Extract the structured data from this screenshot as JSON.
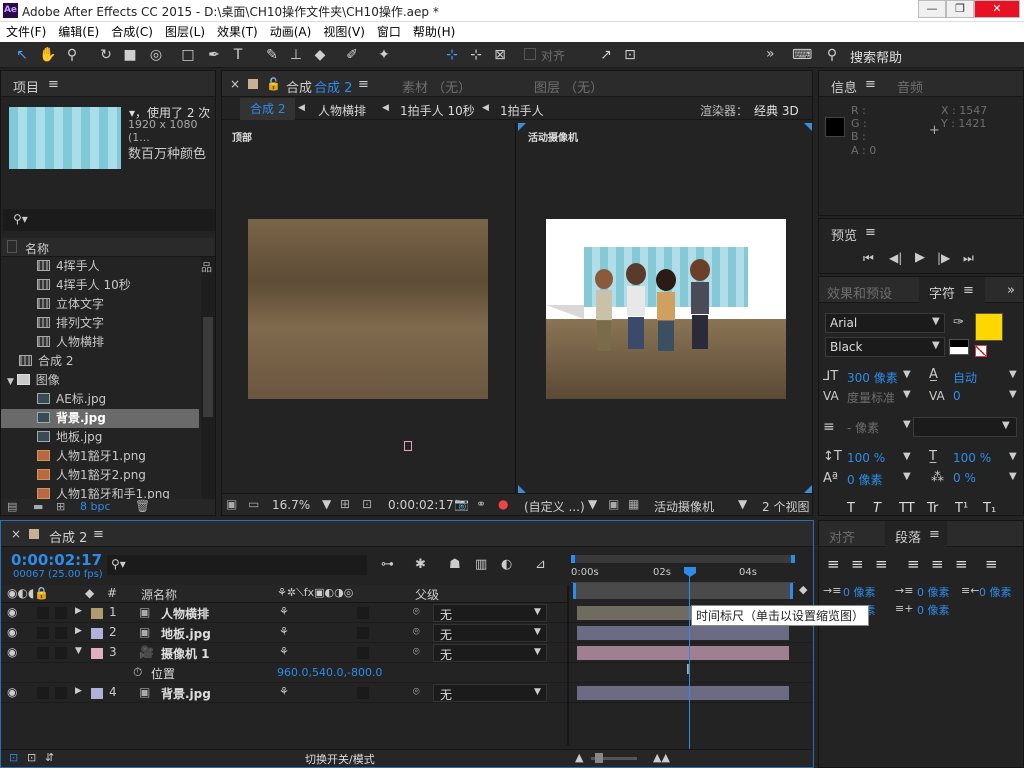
{
  "window": {
    "app_badge": "Ae",
    "title": "Adobe After Effects CC 2015 - D:\\桌面\\CH10操作文件夹\\CH10操作.aep *",
    "minimize": "—",
    "restore": "❐",
    "close": "✕"
  },
  "menu": [
    "文件(F)",
    "编辑(E)",
    "合成(C)",
    "图层(L)",
    "效果(T)",
    "动画(A)",
    "视图(V)",
    "窗口",
    "帮助(H)"
  ],
  "toolbar": {
    "align_label": "对齐",
    "search_help": "搜索帮助",
    "more": "»"
  },
  "project": {
    "tab": "项目",
    "menu_icon": "≡",
    "used_text": "▾，使用了 2 次",
    "dims": "1920 x 1080 (1...",
    "colors": "数百万种颜色",
    "search_icon": "⚲▾",
    "col_name": "名称",
    "items": [
      {
        "name": "4挥手人",
        "type": "comp",
        "indent": 1
      },
      {
        "name": "4挥手人 10秒",
        "type": "comp",
        "indent": 1
      },
      {
        "name": "立体文字",
        "type": "comp",
        "indent": 1
      },
      {
        "name": "排列文字",
        "type": "comp",
        "indent": 1
      },
      {
        "name": "人物横排",
        "type": "comp",
        "indent": 1
      },
      {
        "name": "合成 2",
        "type": "comp",
        "indent": 0
      },
      {
        "name": "图像",
        "type": "folder",
        "indent": 0
      },
      {
        "name": "AE标.jpg",
        "type": "img",
        "indent": 1
      },
      {
        "name": "背景.jpg",
        "type": "img",
        "indent": 1,
        "selected": true
      },
      {
        "name": "地板.jpg",
        "type": "img",
        "indent": 1
      },
      {
        "name": "人物1豁牙1.png",
        "type": "png",
        "indent": 1
      },
      {
        "name": "人物1豁牙2.png",
        "type": "png",
        "indent": 1
      },
      {
        "name": "人物1豁牙和手1.png",
        "type": "png",
        "indent": 1
      }
    ],
    "bpc": "8 bpc"
  },
  "comp_viewer": {
    "close": "×",
    "tab_prefix": "合成",
    "tab_name": "合成 2",
    "menu_icon": "≡",
    "footage_tab": "素材 （无）",
    "layer_tab": "图层 （无）",
    "breadcrumbs": [
      "合成 2",
      "人物横排",
      "1拍手人 10秒",
      "1拍手人"
    ],
    "renderer_label": "渲染器：",
    "renderer_value": "经典 3D",
    "view_left_label": "顶部",
    "view_right_label": "活动摄像机",
    "zoom": "16.7%",
    "timecode": "0:00:02:17",
    "resolution": "(自定义 ...)",
    "camera": "活动摄像机",
    "views": "2 个视图"
  },
  "info": {
    "tab": "信息",
    "menu_icon": "≡",
    "audio_tab": "音频",
    "r": "R :",
    "g": "G :",
    "b": "B :",
    "a": "A : 0",
    "x": "X : 1547",
    "y": "Y : 1421"
  },
  "preview": {
    "tab": "预览",
    "menu_icon": "≡",
    "controls": [
      "⏮",
      "◀|",
      "▶",
      "|▶",
      "⏭"
    ]
  },
  "character": {
    "effects_tab": "效果和预设",
    "char_tab": "字符",
    "menu_icon": "≡",
    "more": "»",
    "font": "Arial",
    "style": "Black",
    "size": "300 像素",
    "leading": "自动",
    "kerning": "度量标准",
    "tracking": "0",
    "stroke": "- 像素",
    "vscale": "100 %",
    "hscale": "100 %",
    "baseline": "0 像素",
    "tsume": "0 %",
    "fill_color": "#ffd700",
    "style_buttons": [
      "T",
      "T",
      "TT",
      "Tr",
      "T¹",
      "T₁"
    ]
  },
  "paragraph": {
    "align_tab": "对齐",
    "para_tab": "段落",
    "menu_icon": "≡",
    "indent_left": "0 像素",
    "indent_first": "0 像素",
    "indent_right": "0 像素",
    "space_before": "0 像素",
    "space_after": "0 像素"
  },
  "timeline": {
    "close": "×",
    "tab": "合成 2",
    "menu_icon": "≡",
    "timecode": "0:00:02:17",
    "frames": "00067 (25.00 fps)",
    "col_num": "#",
    "col_source": "源名称",
    "col_parent": "父级",
    "ruler": [
      "0:00s",
      "02s",
      "04s"
    ],
    "layers": [
      {
        "num": "1",
        "name": "人物横排",
        "parent": "无",
        "color": "#b09a72",
        "bar": "#6f6b5e",
        "icon": "comp"
      },
      {
        "num": "2",
        "name": "地板.jpg",
        "parent": "无",
        "color": "#b0b0d8",
        "bar": "#6b6b84",
        "icon": "img"
      },
      {
        "num": "3",
        "name": "摄像机 1",
        "parent": "无",
        "color": "#e0b0c0",
        "bar": "#a08090",
        "icon": "cam"
      },
      {
        "num": "4",
        "name": "背景.jpg",
        "parent": "无",
        "color": "#b0b0d8",
        "bar": "#6b6b84",
        "icon": "img"
      }
    ],
    "position_label": "位置",
    "position_value": "960.0,540.0,-800.0",
    "tooltip": "时间标尺（单击以设置缩览图）",
    "toggle_label": "切换开关/模式"
  }
}
